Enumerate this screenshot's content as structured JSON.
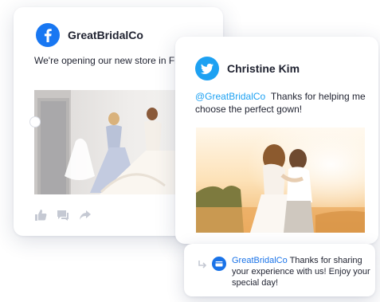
{
  "facebook_post": {
    "account_name": "GreatBridalCo",
    "logo_icon": "facebook-icon",
    "text": "We're opening our new store in Fre CA tomorrow! Stop by!",
    "actions": [
      "like-icon",
      "comment-icon",
      "share-icon"
    ]
  },
  "twitter_post": {
    "account_name": "Christine Kim",
    "logo_icon": "twitter-icon",
    "mention": "@GreatBridalCo",
    "text": "Thanks for helping me choose the perfect gown!"
  },
  "reply": {
    "handle": "GreatBridalCo",
    "text": "Thanks for sharing your experience with us! Enjoy your special day!"
  },
  "colors": {
    "facebook_blue": "#1877f2",
    "twitter_blue": "#1da1f2",
    "reply_blue": "#1a73e8",
    "action_gray": "#c5c9d3"
  }
}
